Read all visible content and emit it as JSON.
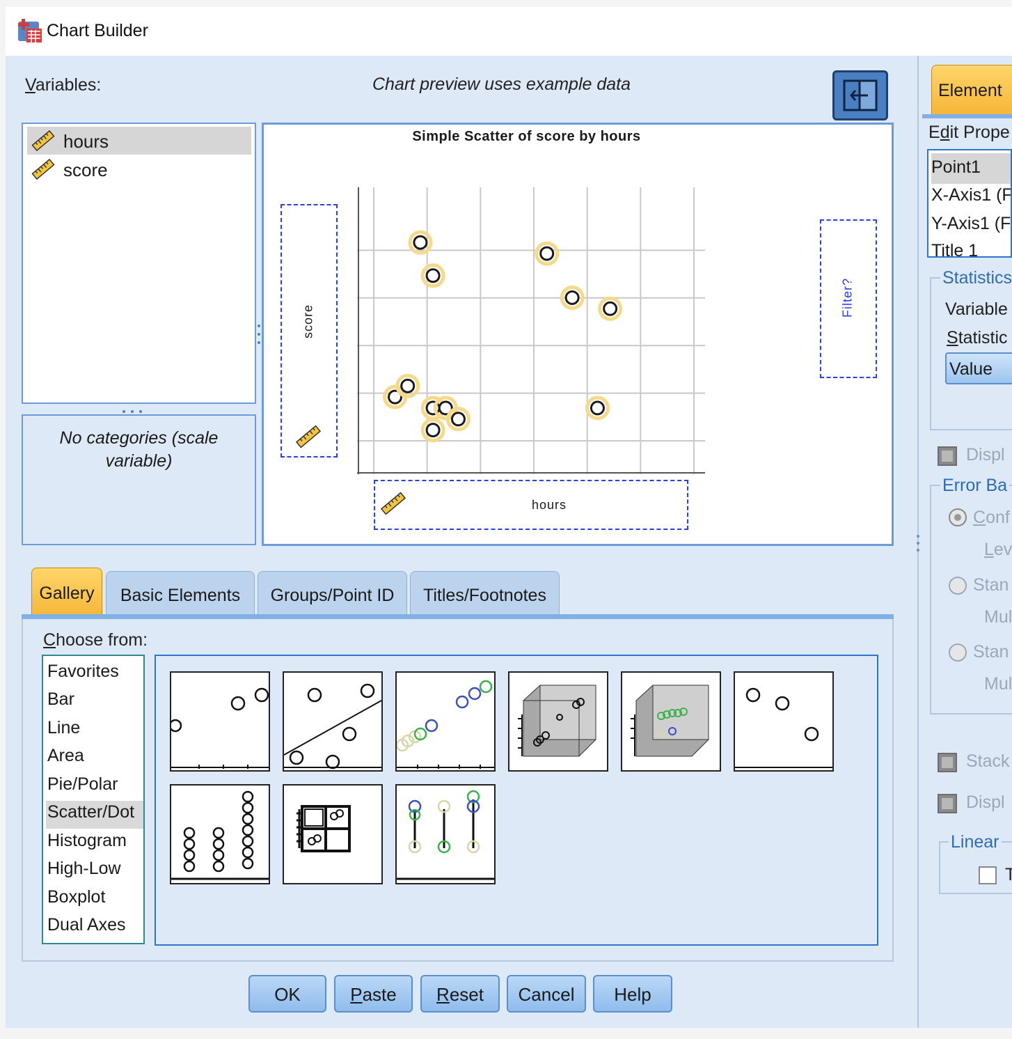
{
  "window": {
    "title": "Chart Builder"
  },
  "variables": {
    "label": "Variables:",
    "items": [
      {
        "name": "hours"
      },
      {
        "name": "score"
      }
    ],
    "category_note_line1": "No categories (scale",
    "category_note_line2": "variable)"
  },
  "preview": {
    "caption": "Chart preview uses example data",
    "chart_title": "Simple Scatter of score by hours",
    "y_drop_label": "score",
    "x_drop_label": "hours",
    "filter_label": "Filter?"
  },
  "chart_data": {
    "type": "scatter",
    "title": "Simple Scatter of score by hours",
    "xlabel": "hours",
    "ylabel": "score",
    "x_ticks_count": 6,
    "y_ticks_count": 5,
    "grid": true,
    "xlim": [
      0,
      5.5
    ],
    "ylim": [
      0,
      5.2
    ],
    "points": [
      {
        "x": 1.0,
        "y": 4.2
      },
      {
        "x": 1.2,
        "y": 3.6
      },
      {
        "x": 3.0,
        "y": 4.0
      },
      {
        "x": 3.4,
        "y": 3.2
      },
      {
        "x": 4.0,
        "y": 3.0
      },
      {
        "x": 0.6,
        "y": 1.4
      },
      {
        "x": 0.8,
        "y": 1.6
      },
      {
        "x": 1.2,
        "y": 1.2
      },
      {
        "x": 1.4,
        "y": 1.2
      },
      {
        "x": 1.6,
        "y": 1.0
      },
      {
        "x": 1.2,
        "y": 0.8
      },
      {
        "x": 3.8,
        "y": 1.2
      }
    ],
    "point_style": {
      "stroke": "#1a1a1a",
      "halo": "#f7d98a"
    }
  },
  "tabs": [
    {
      "label": "Gallery",
      "active": true
    },
    {
      "label": "Basic Elements",
      "active": false
    },
    {
      "label": "Groups/Point ID",
      "active": false
    },
    {
      "label": "Titles/Footnotes",
      "active": false
    }
  ],
  "gallery": {
    "choose_label": "Choose from:",
    "types": [
      "Favorites",
      "Bar",
      "Line",
      "Area",
      "Pie/Polar",
      "Scatter/Dot",
      "Histogram",
      "High-Low",
      "Boxplot",
      "Dual Axes"
    ],
    "selected": "Scatter/Dot",
    "thumbnails": [
      "simple-scatter",
      "simple-scatter-fit-line",
      "grouped-scatter",
      "simple-3d-scatter",
      "grouped-3d-scatter",
      "summary-point-plot",
      "simple-dot-plot",
      "scatterplot-matrix",
      "drop-line"
    ]
  },
  "buttons": {
    "ok": "OK",
    "paste": "Paste",
    "reset": "Reset",
    "cancel": "Cancel",
    "help": "Help"
  },
  "element_properties": {
    "tab_label": "Element",
    "edit_label": "Edit Prope",
    "items": [
      "Point1",
      "X-Axis1 (F",
      "Y-Axis1 (F",
      "Title 1"
    ],
    "statistics_title": "Statistics",
    "variable_label": "Variable",
    "statistic_label": "Statistic",
    "statistic_value": "Value",
    "display_label_1": "Displ",
    "error_bars_title": "Error Ba",
    "conf_label": "Conf",
    "level_label": "Lev",
    "stand_label_1": "Stan",
    "mult_label_1": "Mul",
    "stand_label_2": "Stan",
    "mult_label_2": "Mul",
    "stack_label": "Stack",
    "display_label_2": "Displ",
    "linear_title": "Linear",
    "linear_chk_label": "T"
  }
}
